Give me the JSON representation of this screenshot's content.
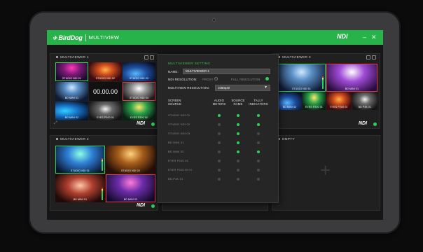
{
  "titlebar": {
    "brand": "BirdDog",
    "product": "MULTIVIEW",
    "ndi_logo": "NDI",
    "minimize_glyph": "–",
    "close_glyph": "✕",
    "accent_color": "#27b34a"
  },
  "panels": [
    {
      "title": "MULTIVIEWER 1",
      "clock": "00.00.00",
      "footer_logo": "NDI",
      "cells": [
        {
          "label": "STUDIO NDI 01",
          "state": "live"
        },
        {
          "label": "STUDIO NDI 02",
          "state": "none"
        },
        {
          "label": "STUDIO NDI 03",
          "state": "none"
        },
        {
          "label": "",
          "state": "clock"
        },
        {
          "label": "STUDIO NDI 04",
          "state": "prog"
        },
        {
          "label": "BD MINI 01",
          "state": "none"
        },
        {
          "label": "BD MINI 02",
          "state": "none"
        },
        {
          "label": "EYES P200 01",
          "state": "none"
        },
        {
          "label": "EYES P200 02",
          "state": "none"
        }
      ]
    },
    {
      "title": "MULTIVIEWER 2",
      "footer_logo": "NDI",
      "cells": [
        {
          "label": "STUDIO NDI 01",
          "state": "live"
        },
        {
          "label": "STUDIO NDI 02",
          "state": "none"
        },
        {
          "label": "BD MINI 01",
          "state": "none"
        },
        {
          "label": "BD MINI 02",
          "state": "prog"
        }
      ]
    },
    {
      "title": "MULTIVIEWER 3",
      "footer_logo": "NDI",
      "cells": [
        {
          "label": "STUDIO NDI 01",
          "state": "live"
        },
        {
          "label": "BD MINI 01",
          "state": "prog"
        },
        {
          "label": "BD MINI 02",
          "state": "none"
        },
        {
          "label": "EYES P200 01",
          "state": "none"
        },
        {
          "label": "EYES P200 02",
          "state": "none"
        },
        {
          "label": "BD P4K 01",
          "state": "none"
        }
      ]
    },
    {
      "title": "EMPTY",
      "plus": "+"
    }
  ],
  "settings": {
    "title": "MULTIVIEWER SETTING",
    "name_label": "NAME:",
    "name_value": "MULTIVIEWER 1",
    "ndi_res_label": "NDI RESOLUTION:",
    "ndi_res_options": [
      "PROXY",
      "FULL RESOLUTION"
    ],
    "ndi_res_selected": "FULL RESOLUTION",
    "mv_res_label": "MULTIVIEW RESOLUTION:",
    "mv_res_value": "1080p30",
    "columns": {
      "source": "SCREEN SOURCE",
      "audio": "AUDIO METERS",
      "name": "SOURCE NAME",
      "tally": "TALLY INDICATORS"
    },
    "sources": [
      {
        "name": "STUDIO NDI 01",
        "audio": true,
        "source_name": true,
        "tally": true
      },
      {
        "name": "STUDIO NDI 02",
        "audio": false,
        "source_name": true,
        "tally": true
      },
      {
        "name": "STUDIO NDI 03",
        "audio": false,
        "source_name": true,
        "tally": false
      },
      {
        "name": "BD MINI 01",
        "audio": false,
        "source_name": true,
        "tally": false
      },
      {
        "name": "BD MINI 02",
        "audio": false,
        "source_name": true,
        "tally": true
      },
      {
        "name": "EYES P200 01",
        "audio": false,
        "source_name": false,
        "tally": false
      },
      {
        "name": "EYES P200 W 01",
        "audio": false,
        "source_name": false,
        "tally": false
      },
      {
        "name": "BD P4K 01",
        "audio": false,
        "source_name": false,
        "tally": false
      }
    ]
  }
}
